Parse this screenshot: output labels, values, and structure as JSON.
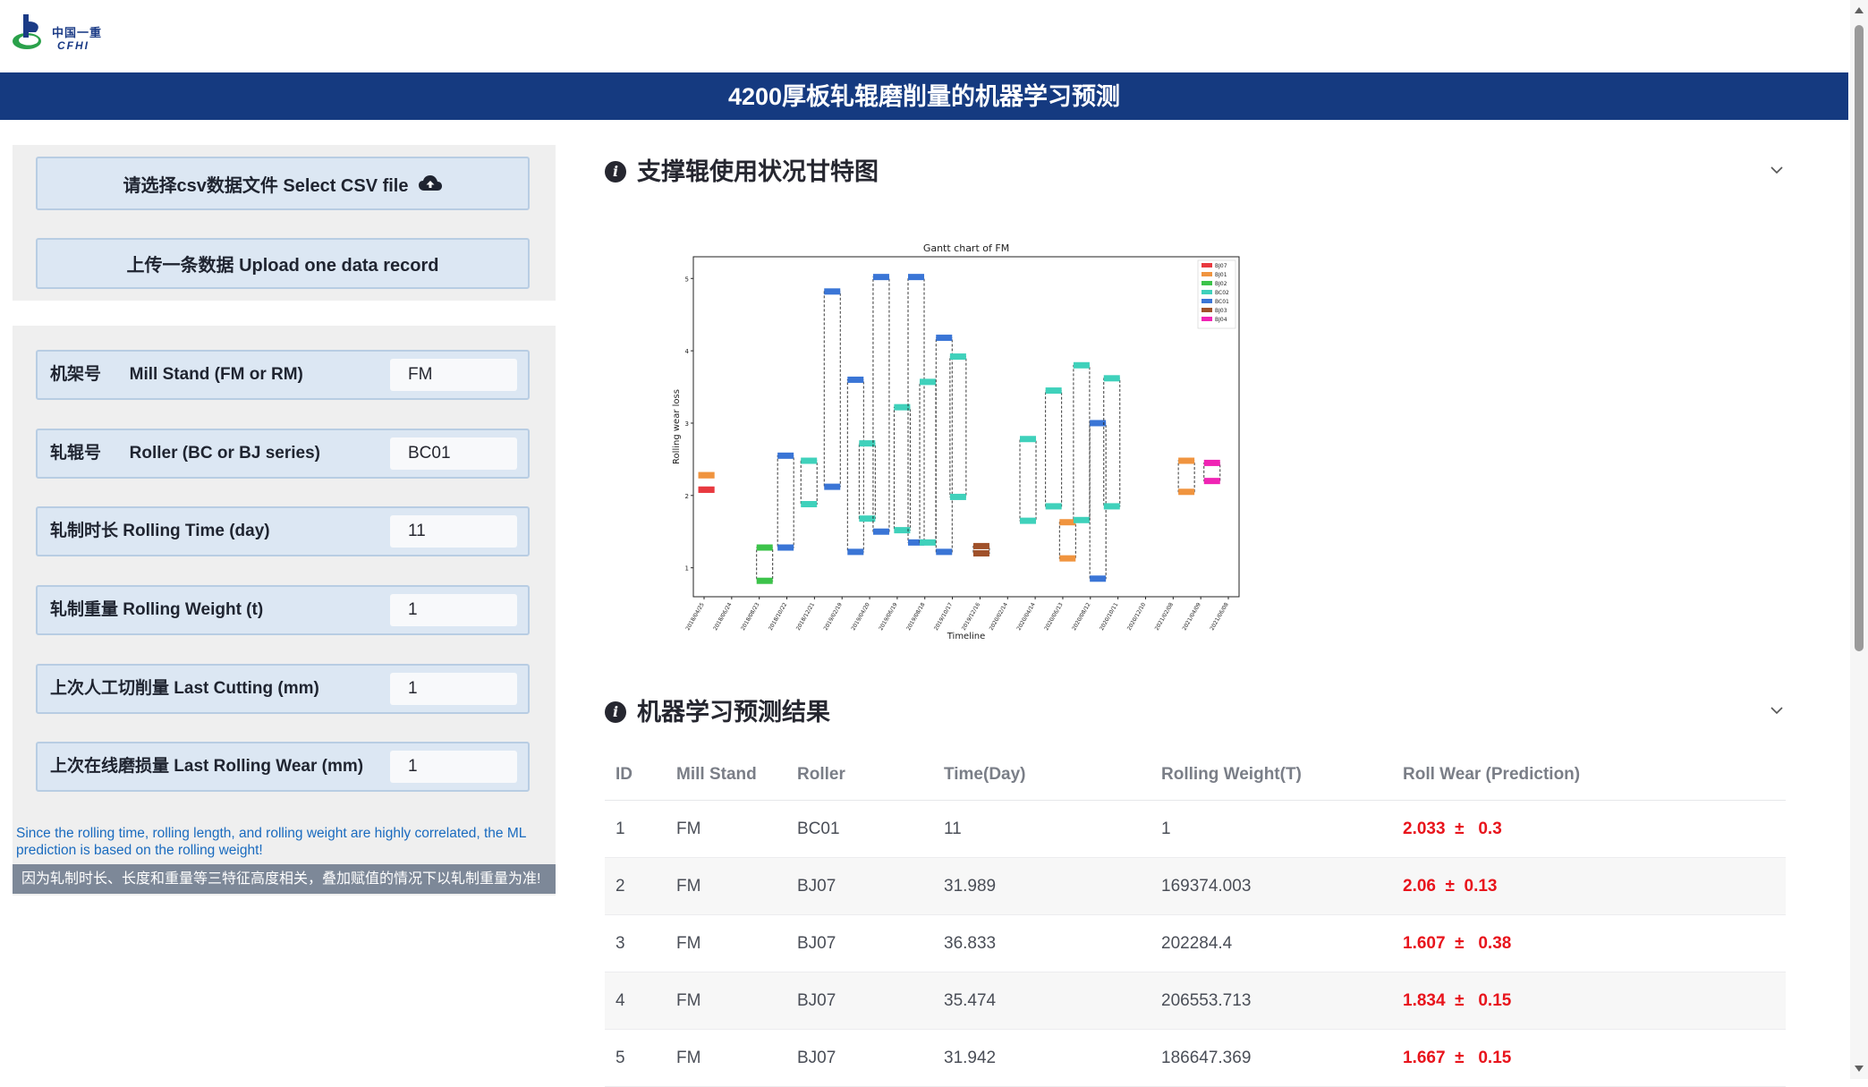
{
  "logo": {
    "zh": "中国一重",
    "en": "CFHI"
  },
  "page_title": "4200厚板轧辊磨削量的机器学习预测",
  "sidebar": {
    "select_csv_label": "请选择csv数据文件 Select CSV file",
    "upload_record_label": "上传一条数据 Upload one data record",
    "fields": [
      {
        "label": "机架号      Mill Stand (FM or RM)",
        "value": "FM"
      },
      {
        "label": "轧辊号      Roller (BC or BJ series)",
        "value": "BC01"
      },
      {
        "label": "轧制时长 Rolling Time (day)",
        "value": "11"
      },
      {
        "label": "轧制重量 Rolling Weight (t)",
        "value": "1"
      },
      {
        "label": "上次人工切削量 Last Cutting (mm)",
        "value": "1"
      },
      {
        "label": "上次在线磨损量 Last Rolling Wear (mm)",
        "value": "1"
      }
    ],
    "note_en": "Since the rolling time, rolling length, and rolling weight are highly correlated, the ML prediction is based on the rolling weight!",
    "note_zh": "因为轧制时长、长度和重量等三特征高度相关，叠加赋值的情况下以轧制重量为准!"
  },
  "sections": {
    "gantt_title": "支撑辊使用状况甘特图",
    "results_title": "机器学习预测结果"
  },
  "chart_data": {
    "type": "gantt",
    "title": "Gantt chart of FM",
    "xlabel": "Timeline",
    "ylabel": "Rolling wear loss",
    "ylim": [
      0.6,
      5.3
    ],
    "yticks": [
      1,
      2,
      3,
      4,
      5
    ],
    "xticks": [
      "2018/04/25",
      "2018/06/24",
      "2018/08/23",
      "2018/10/22",
      "2018/12/21",
      "2019/02/19",
      "2019/04/20",
      "2019/06/19",
      "2019/08/18",
      "2019/10/17",
      "2019/12/16",
      "2020/02/14",
      "2020/04/14",
      "2020/06/13",
      "2020/08/12",
      "2020/10/11",
      "2020/12/10",
      "2021/02/08",
      "2021/04/09",
      "2021/06/08"
    ],
    "legend": [
      {
        "name": "BJ07",
        "color": "#e8393f"
      },
      {
        "name": "BJ01",
        "color": "#f0943f"
      },
      {
        "name": "BJ02",
        "color": "#3cc34a"
      },
      {
        "name": "BC02",
        "color": "#3fd1bb"
      },
      {
        "name": "BC01",
        "color": "#3a75d6"
      },
      {
        "name": "BJ03",
        "color": "#a0512a"
      },
      {
        "name": "BJ04",
        "color": "#f024b4"
      }
    ],
    "legend_position": "top-right",
    "bars": [
      {
        "roller": "BJ01",
        "x": 0.1,
        "y0": 2.28,
        "y1": 2.28
      },
      {
        "roller": "BJ07",
        "x": 0.1,
        "y0": 2.08,
        "y1": 2.08
      },
      {
        "roller": "BJ02",
        "x": 2.6,
        "y0": 1.28,
        "y1": 0.82
      },
      {
        "roller": "BC01",
        "x": 3.5,
        "y0": 2.55,
        "y1": 1.28
      },
      {
        "roller": "BC02",
        "x": 4.5,
        "y0": 2.48,
        "y1": 1.88
      },
      {
        "roller": "BC01",
        "x": 5.5,
        "y0": 4.82,
        "y1": 2.12
      },
      {
        "roller": "BC01",
        "x": 6.5,
        "y0": 3.6,
        "y1": 1.22
      },
      {
        "roller": "BC02",
        "x": 7.0,
        "y0": 2.72,
        "y1": 1.68
      },
      {
        "roller": "BC01",
        "x": 7.6,
        "y0": 5.02,
        "y1": 1.5
      },
      {
        "roller": "BC02",
        "x": 8.5,
        "y0": 3.22,
        "y1": 1.52
      },
      {
        "roller": "BC01",
        "x": 9.1,
        "y0": 5.02,
        "y1": 1.35
      },
      {
        "roller": "BC02",
        "x": 9.6,
        "y0": 3.57,
        "y1": 1.35
      },
      {
        "roller": "BC01",
        "x": 10.3,
        "y0": 4.18,
        "y1": 1.22
      },
      {
        "roller": "BC02",
        "x": 10.9,
        "y0": 3.92,
        "y1": 1.98
      },
      {
        "roller": "BJ03",
        "x": 11.9,
        "y0": 1.3,
        "y1": 1.2
      },
      {
        "roller": "BC02",
        "x": 13.9,
        "y0": 2.78,
        "y1": 1.65
      },
      {
        "roller": "BC02",
        "x": 15.0,
        "y0": 3.45,
        "y1": 1.85
      },
      {
        "roller": "BJ01",
        "x": 15.6,
        "y0": 1.63,
        "y1": 1.13
      },
      {
        "roller": "BC02",
        "x": 16.2,
        "y0": 3.8,
        "y1": 1.66
      },
      {
        "roller": "BC01",
        "x": 16.9,
        "y0": 3.0,
        "y1": 0.85
      },
      {
        "roller": "BC02",
        "x": 17.5,
        "y0": 3.62,
        "y1": 1.85
      },
      {
        "roller": "BJ01",
        "x": 20.7,
        "y0": 2.48,
        "y1": 2.05
      },
      {
        "roller": "BJ04",
        "x": 21.8,
        "y0": 2.45,
        "y1": 2.2
      }
    ]
  },
  "results_table": {
    "headers": [
      "ID",
      "Mill Stand",
      "Roller",
      "Time(Day)",
      "Rolling Weight(T)",
      "Roll Wear (Prediction)"
    ],
    "rows": [
      [
        "1",
        "FM",
        "BC01",
        "11",
        "1",
        "2.033  ±   0.3"
      ],
      [
        "2",
        "FM",
        "BJ07",
        "31.989",
        "169374.003",
        "2.06  ±  0.13"
      ],
      [
        "3",
        "FM",
        "BJ07",
        "36.833",
        "202284.4",
        "1.607  ±   0.38"
      ],
      [
        "4",
        "FM",
        "BJ07",
        "35.474",
        "206553.713",
        "1.834  ±   0.15"
      ],
      [
        "5",
        "FM",
        "BJ07",
        "31.942",
        "186647.369",
        "1.667  ±   0.15"
      ]
    ]
  }
}
